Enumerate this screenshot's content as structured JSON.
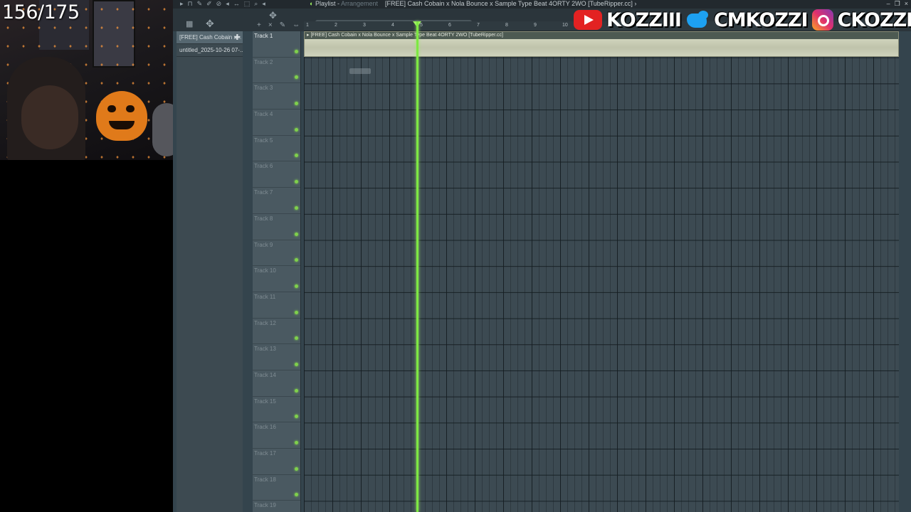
{
  "overlay": {
    "counter": "156/175",
    "socials": [
      {
        "icon": "youtube-icon",
        "handle": "KOZZIII"
      },
      {
        "icon": "twitter-icon",
        "handle": "CMKOZZI"
      },
      {
        "icon": "instagram-icon",
        "handle": "CKOZZI"
      }
    ]
  },
  "window": {
    "title_prefix": "Playlist - ",
    "title_mode": "Arrangement",
    "title_project": "[FREE] Cash Cobain x Nola Bounce x Sample Type Beat 4ORTY 2WO [TubeRipper.cc]",
    "title_arrow": "›"
  },
  "browser": {
    "items": [
      {
        "label": "[FREE] Cash Cobain x...",
        "plus": "✚"
      },
      {
        "label": "untitled_2025-10-26 07-..."
      }
    ]
  },
  "ruler": {
    "bars": [
      "1",
      "2",
      "3",
      "4",
      "5",
      "6",
      "7",
      "8",
      "9",
      "10"
    ]
  },
  "playlist": {
    "clip_label": "▸ [FREE] Cash Cobain x Nola Bounce x Sample Type Beat 4ORTY 2WO [TubeRipper.cc]",
    "tracks": [
      "Track 1",
      "Track 2",
      "Track 3",
      "Track 4",
      "Track 5",
      "Track 6",
      "Track 7",
      "Track 8",
      "Track 9",
      "Track 10",
      "Track 11",
      "Track 12",
      "Track 13",
      "Track 14",
      "Track 15",
      "Track 16",
      "Track 17",
      "Track 18",
      "Track 19"
    ]
  },
  "colors": {
    "playhead": "#7ee843",
    "youtube": "#e32222",
    "twitter": "#1da1f2"
  }
}
